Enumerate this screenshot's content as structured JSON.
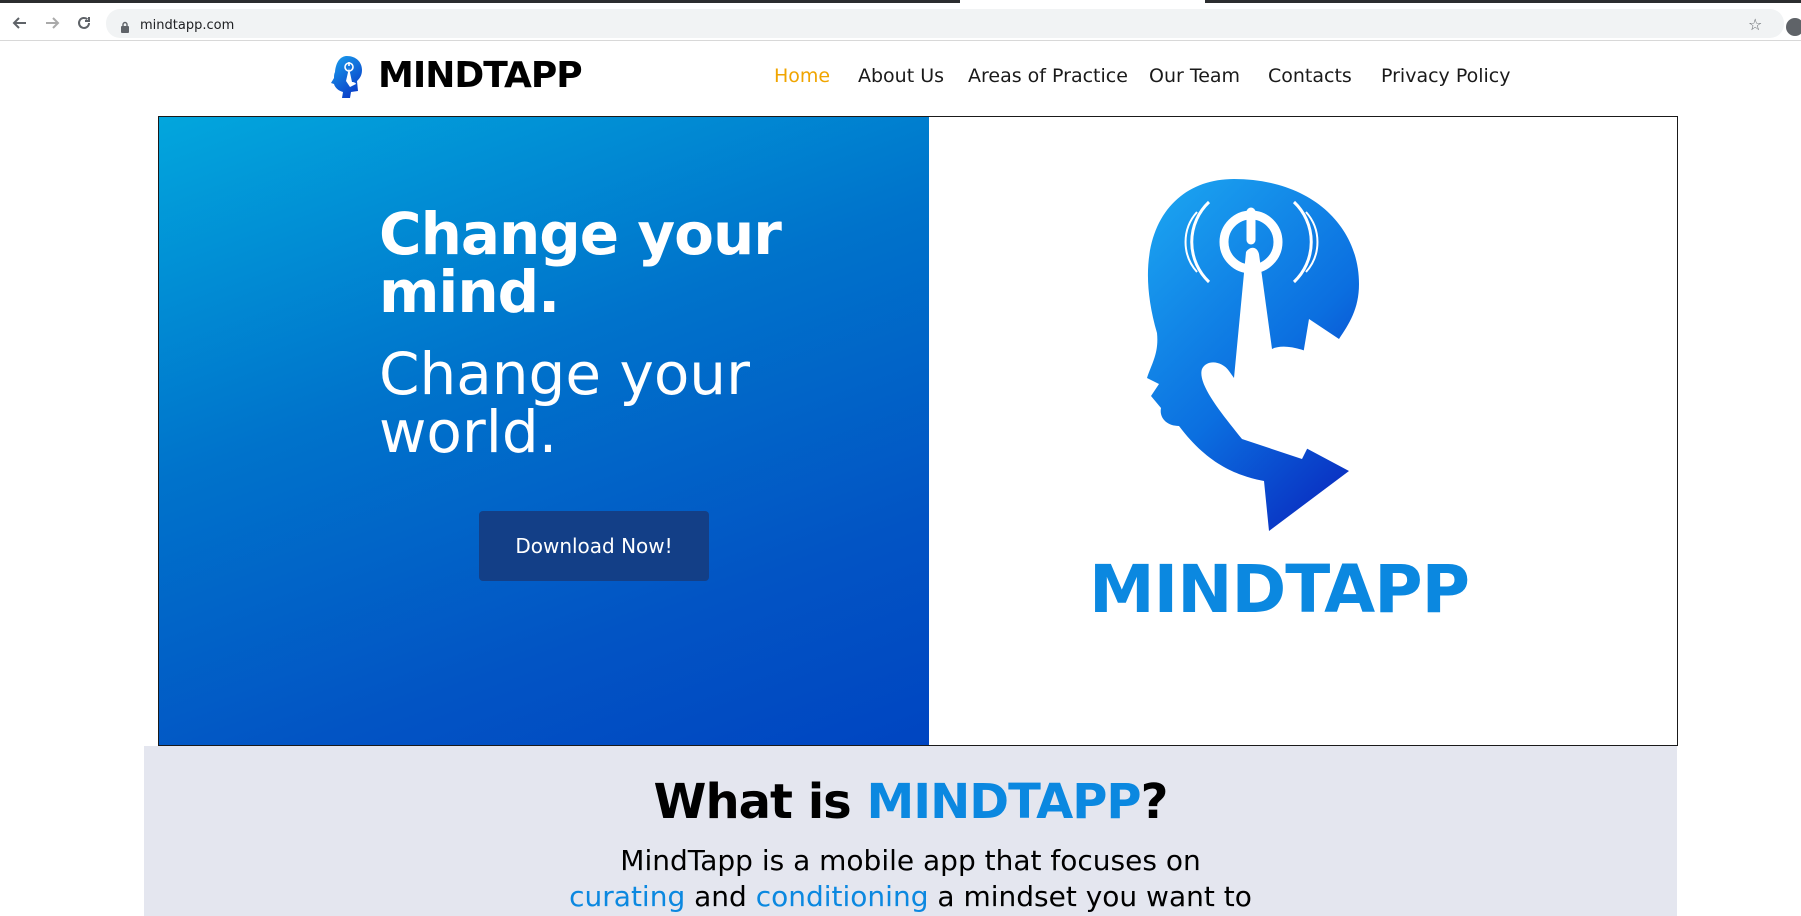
{
  "browser": {
    "url": "mindtapp.com",
    "back_icon": "arrow-left-icon",
    "forward_icon": "arrow-right-icon",
    "reload_icon": "reload-icon",
    "bookmark_icon": "star-icon"
  },
  "header": {
    "logo_text": "MINDTAPP",
    "nav": [
      {
        "label": "Home",
        "active": true
      },
      {
        "label": "About Us"
      },
      {
        "label": "Areas of Practice"
      },
      {
        "label": "Our Team"
      },
      {
        "label": "Contacts"
      },
      {
        "label": "Privacy Policy"
      }
    ]
  },
  "hero": {
    "headline_bold": "Change your mind.",
    "headline_light": "Change your world.",
    "cta_label": "Download Now!",
    "brand_text": "MINDTAPP"
  },
  "about": {
    "title_prefix": "What is ",
    "title_accent": "MINDTAPP",
    "title_suffix": "?",
    "line1": "MindTapp is a mobile app that focuses on",
    "line2_accent1": "curating",
    "line2_mid": " and ",
    "line2_accent2": "conditioning",
    "line2_end": " a mindset you want to"
  },
  "colors": {
    "accent": "#0b88e0",
    "nav_active": "#f0a500",
    "cta_bg": "#133f87",
    "about_bg": "#e4e6ef"
  }
}
